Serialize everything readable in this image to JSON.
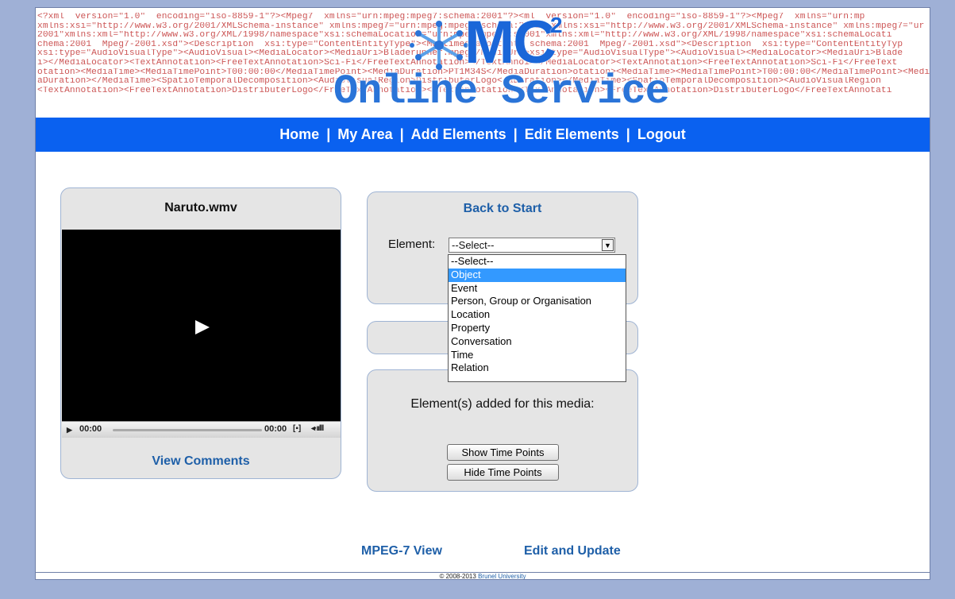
{
  "banner": {
    "xml_lines": [
      "<?xml  version=\"1.0\"  encoding=\"iso-8859-1\"?><Mpeg7  xmlns=\"urn:mpeg:mpeg7:schema:2001\"?><ml  version=\"1.0\"  encoding=\"iso-8859-1\"?><Mpeg7  xmlns=\"urn:mp",
      "xmlns:xsi=\"http://www.w3.org/2001/XMLSchema-instance\" xmlns:mpeg7=\"urn:mpeg:mpeg7:schema:2001\" xmlns:xsi=\"http://www.w3.org/2001/XMLSchema-instance\" xmlns:mpeg7=\"ur",
      "2001\"xmlns:xml=\"http://www.w3.org/XML/1998/namespace\"xsi:schemaLocation=\"urn:mpeg:mpeg7:s2001\"xmlns:xml=\"http://www.w3.org/XML/1998/namespace\"xsi:schemaLocati",
      "chema:2001  Mpeg7-2001.xsd\"><Description  xsi:type=\"ContentEntityType\"><MultimediaContent  schema:2001  Mpeg7-2001.xsd\"><Description  xsi:type=\"ContentEntityTyp",
      "xsi:type=\"AudioVisualType\"><AudioVisual><MediaLocator><MediaUri>Bladerunner.mpeg</MediaUri>xsi:type=\"AudioVisualType\"><AudioVisual><MediaLocator><MediaUri>Blade",
      "i></MediaLocator><TextAnnotation><FreeTextAnnotation>Sci-Fi</FreeTextAnnotation></TextAnnoi></MediaLocator><TextAnnotation><FreeTextAnnotation>Sci-Fi</FreeText",
      "otation><MediaTime><MediaTimePoint>T00:00:00</MediaTimePoint><MediaDuration>PT1M34S</MediaDuration>otation><MediaTime><MediaTimePoint>T00:00:00</MediaTimePoint><MediaDu",
      "aDuration></MediaTime><SpatioTemporalDecomposition><AudioVisualRegion>DistributerLogo</aDuration></MediaTime><SpatioTemporalDecomposition><AudioVisualRegion",
      "<TextAnnotation><FreeTextAnnotation>DistributerLogo</FreeTextAnnotation></TextAnnotation><TextAnnotation><FreeTextAnnotation>DistributerLogo</FreeTextAnnotati"
    ],
    "logo_mc": "MC",
    "logo_sup": "2",
    "logo_online": "Online Service"
  },
  "nav": {
    "items": [
      "Home",
      "My Area",
      "Add Elements",
      "Edit Elements",
      "Logout"
    ],
    "separator": "|"
  },
  "media": {
    "title": "Naruto.wmv",
    "controls": {
      "play": "▶",
      "time_start": "00:00",
      "time_end": "00:00",
      "fullscreen": "[▪]",
      "volume": "◂·ıılll"
    },
    "view_comments": "View Comments"
  },
  "element_panel": {
    "back_to_start": "Back to Start",
    "label": "Element:",
    "selected": "--Select--",
    "arrow": "▼",
    "options": [
      "--Select--",
      "Object",
      "Event",
      "Person, Group or Organisation",
      "Location",
      "Property",
      "Conversation",
      "Time",
      "Relation"
    ],
    "highlighted_option": "Object"
  },
  "added_panel": {
    "text": "Element(s) added for this media:",
    "show_button": "Show Time Points",
    "hide_button": "Hide Time Points"
  },
  "bottom_links": {
    "mpeg7_view": "MPEG-7 View",
    "edit_update": "Edit and Update"
  },
  "footer": {
    "copyright": "© 2008-2013 ",
    "link": "Brunel University"
  },
  "colors": {
    "nav_bar": "#0a61f0",
    "page_background": "#9fb0d6",
    "link_blue": "#1e5fa8",
    "logo_blue": "#1a66d8",
    "highlight": "#3399ff"
  }
}
